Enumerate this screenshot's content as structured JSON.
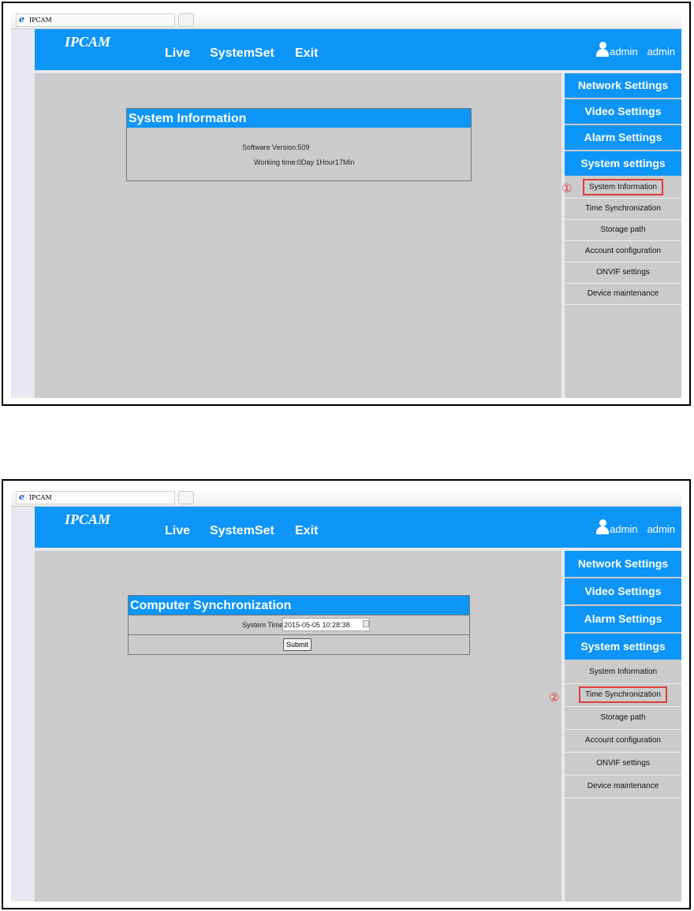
{
  "browser": {
    "tab_title": "IPCAM"
  },
  "header": {
    "brand": "IPCAM",
    "nav": [
      "Live",
      "SystemSet",
      "Exit"
    ],
    "user_label": "admin",
    "user_name": "admin"
  },
  "sidebar": {
    "categories": [
      "Network Settings",
      "Video Settings",
      "Alarm Settings",
      "System settings"
    ],
    "items": [
      "System Information",
      "Time Synchronization",
      "Storage path",
      "Account configuration",
      "ONVIF settings",
      "Device maintenance"
    ]
  },
  "screen1": {
    "marker": "①",
    "panel_title": "System Information",
    "software_version": "Software Version:509",
    "working_time": "Working time:0Day 1Hour17Min"
  },
  "screen2": {
    "marker": "②",
    "panel_title": "Computer Synchronization",
    "system_time_label": "System Time",
    "system_time_value": "2015-05-05 10:28:38",
    "submit_label": "Submit"
  },
  "colors": {
    "accent": "#0d95f7",
    "content_bg": "#cbcbcb",
    "highlight": "#e23a3a"
  }
}
